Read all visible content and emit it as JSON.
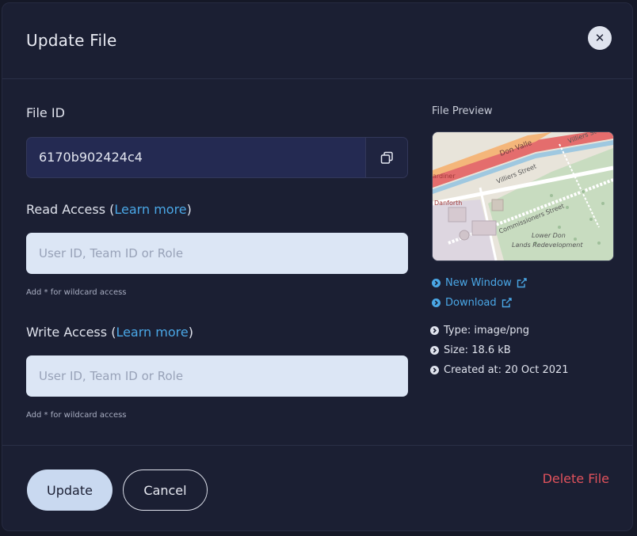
{
  "modal": {
    "title": "Update File",
    "close_icon": "close-icon"
  },
  "file_id": {
    "label": "File ID",
    "value": "6170b902424c4",
    "copy_icon": "copy-icon"
  },
  "read_access": {
    "label_prefix": "Read Access (",
    "link": "Learn more",
    "label_suffix": ")",
    "placeholder": "User ID, Team ID or Role",
    "hint": "Add * for wildcard access"
  },
  "write_access": {
    "label_prefix": "Write Access (",
    "link": "Learn more",
    "label_suffix": ")",
    "placeholder": "User ID, Team ID or Role",
    "hint": "Add * for wildcard access"
  },
  "preview": {
    "label": "File Preview",
    "map_labels": [
      "Don Valle",
      "Villiers St",
      "ardiner",
      "Villiers Street",
      "Danforth",
      "Commissioners Street",
      "Lower Don",
      "Lands Redevelopment"
    ],
    "links": [
      {
        "label": "New Window",
        "icon": "external-link-icon"
      },
      {
        "label": "Download",
        "icon": "external-link-icon"
      }
    ],
    "meta": [
      {
        "label": "Type: image/png"
      },
      {
        "label": "Size: 18.6 kB"
      },
      {
        "label": "Created at: 20 Oct 2021"
      }
    ]
  },
  "footer": {
    "update": "Update",
    "cancel": "Cancel",
    "delete": "Delete File"
  },
  "colors": {
    "accent": "#4aa7e6",
    "danger": "#e0525c",
    "modal_bg": "#1b1f33"
  }
}
